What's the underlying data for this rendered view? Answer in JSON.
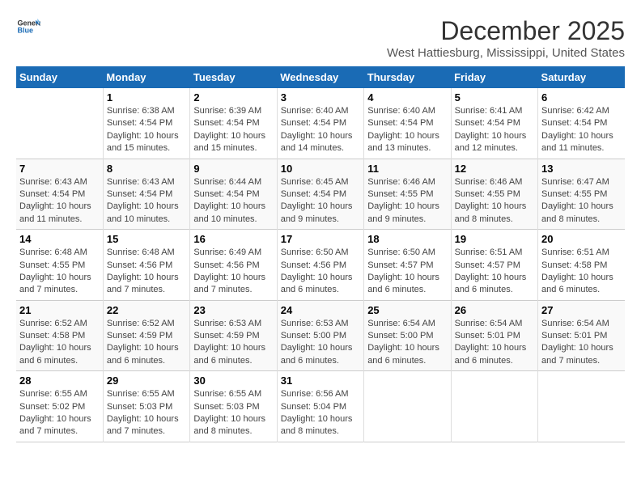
{
  "header": {
    "logo_line1": "General",
    "logo_line2": "Blue",
    "title": "December 2025",
    "subtitle": "West Hattiesburg, Mississippi, United States"
  },
  "calendar": {
    "days_of_week": [
      "Sunday",
      "Monday",
      "Tuesday",
      "Wednesday",
      "Thursday",
      "Friday",
      "Saturday"
    ],
    "weeks": [
      [
        {
          "day": "",
          "info": ""
        },
        {
          "day": "1",
          "info": "Sunrise: 6:38 AM\nSunset: 4:54 PM\nDaylight: 10 hours and 15 minutes."
        },
        {
          "day": "2",
          "info": "Sunrise: 6:39 AM\nSunset: 4:54 PM\nDaylight: 10 hours and 15 minutes."
        },
        {
          "day": "3",
          "info": "Sunrise: 6:40 AM\nSunset: 4:54 PM\nDaylight: 10 hours and 14 minutes."
        },
        {
          "day": "4",
          "info": "Sunrise: 6:40 AM\nSunset: 4:54 PM\nDaylight: 10 hours and 13 minutes."
        },
        {
          "day": "5",
          "info": "Sunrise: 6:41 AM\nSunset: 4:54 PM\nDaylight: 10 hours and 12 minutes."
        },
        {
          "day": "6",
          "info": "Sunrise: 6:42 AM\nSunset: 4:54 PM\nDaylight: 10 hours and 11 minutes."
        }
      ],
      [
        {
          "day": "7",
          "info": "Sunrise: 6:43 AM\nSunset: 4:54 PM\nDaylight: 10 hours and 11 minutes."
        },
        {
          "day": "8",
          "info": "Sunrise: 6:43 AM\nSunset: 4:54 PM\nDaylight: 10 hours and 10 minutes."
        },
        {
          "day": "9",
          "info": "Sunrise: 6:44 AM\nSunset: 4:54 PM\nDaylight: 10 hours and 10 minutes."
        },
        {
          "day": "10",
          "info": "Sunrise: 6:45 AM\nSunset: 4:54 PM\nDaylight: 10 hours and 9 minutes."
        },
        {
          "day": "11",
          "info": "Sunrise: 6:46 AM\nSunset: 4:55 PM\nDaylight: 10 hours and 9 minutes."
        },
        {
          "day": "12",
          "info": "Sunrise: 6:46 AM\nSunset: 4:55 PM\nDaylight: 10 hours and 8 minutes."
        },
        {
          "day": "13",
          "info": "Sunrise: 6:47 AM\nSunset: 4:55 PM\nDaylight: 10 hours and 8 minutes."
        }
      ],
      [
        {
          "day": "14",
          "info": "Sunrise: 6:48 AM\nSunset: 4:55 PM\nDaylight: 10 hours and 7 minutes."
        },
        {
          "day": "15",
          "info": "Sunrise: 6:48 AM\nSunset: 4:56 PM\nDaylight: 10 hours and 7 minutes."
        },
        {
          "day": "16",
          "info": "Sunrise: 6:49 AM\nSunset: 4:56 PM\nDaylight: 10 hours and 7 minutes."
        },
        {
          "day": "17",
          "info": "Sunrise: 6:50 AM\nSunset: 4:56 PM\nDaylight: 10 hours and 6 minutes."
        },
        {
          "day": "18",
          "info": "Sunrise: 6:50 AM\nSunset: 4:57 PM\nDaylight: 10 hours and 6 minutes."
        },
        {
          "day": "19",
          "info": "Sunrise: 6:51 AM\nSunset: 4:57 PM\nDaylight: 10 hours and 6 minutes."
        },
        {
          "day": "20",
          "info": "Sunrise: 6:51 AM\nSunset: 4:58 PM\nDaylight: 10 hours and 6 minutes."
        }
      ],
      [
        {
          "day": "21",
          "info": "Sunrise: 6:52 AM\nSunset: 4:58 PM\nDaylight: 10 hours and 6 minutes."
        },
        {
          "day": "22",
          "info": "Sunrise: 6:52 AM\nSunset: 4:59 PM\nDaylight: 10 hours and 6 minutes."
        },
        {
          "day": "23",
          "info": "Sunrise: 6:53 AM\nSunset: 4:59 PM\nDaylight: 10 hours and 6 minutes."
        },
        {
          "day": "24",
          "info": "Sunrise: 6:53 AM\nSunset: 5:00 PM\nDaylight: 10 hours and 6 minutes."
        },
        {
          "day": "25",
          "info": "Sunrise: 6:54 AM\nSunset: 5:00 PM\nDaylight: 10 hours and 6 minutes."
        },
        {
          "day": "26",
          "info": "Sunrise: 6:54 AM\nSunset: 5:01 PM\nDaylight: 10 hours and 6 minutes."
        },
        {
          "day": "27",
          "info": "Sunrise: 6:54 AM\nSunset: 5:01 PM\nDaylight: 10 hours and 7 minutes."
        }
      ],
      [
        {
          "day": "28",
          "info": "Sunrise: 6:55 AM\nSunset: 5:02 PM\nDaylight: 10 hours and 7 minutes."
        },
        {
          "day": "29",
          "info": "Sunrise: 6:55 AM\nSunset: 5:03 PM\nDaylight: 10 hours and 7 minutes."
        },
        {
          "day": "30",
          "info": "Sunrise: 6:55 AM\nSunset: 5:03 PM\nDaylight: 10 hours and 8 minutes."
        },
        {
          "day": "31",
          "info": "Sunrise: 6:56 AM\nSunset: 5:04 PM\nDaylight: 10 hours and 8 minutes."
        },
        {
          "day": "",
          "info": ""
        },
        {
          "day": "",
          "info": ""
        },
        {
          "day": "",
          "info": ""
        }
      ]
    ]
  }
}
